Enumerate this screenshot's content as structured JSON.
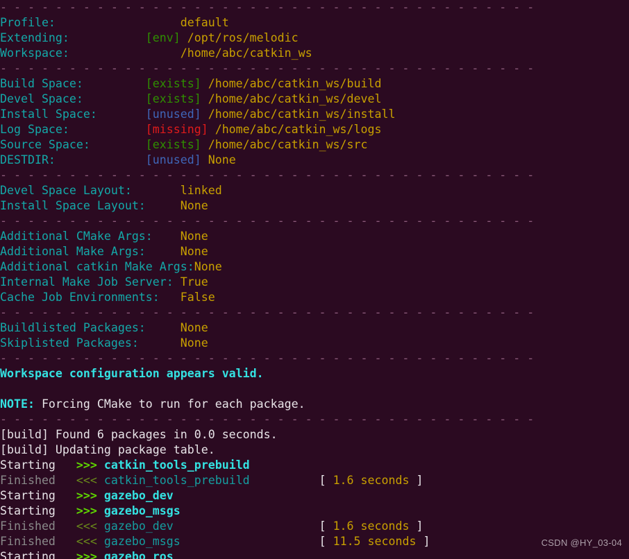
{
  "terminal": {
    "background_color": "#2b0a21",
    "separator_color": "#8b5a7a",
    "label_color": "#14a8a8",
    "value_color": "#c8a000",
    "separator_text": "- - - - - - - - - - - - - - - - - - - - - - - - - - - - - - - - - - - - - - -",
    "watermark": "CSDN @HY_03-04"
  },
  "config": {
    "profile": {
      "label": "Profile:",
      "status": "",
      "value": "default"
    },
    "extending": {
      "label": "Extending:",
      "status": "[env]",
      "status_kind": "ok",
      "value": "/opt/ros/melodic"
    },
    "workspace": {
      "label": "Workspace:",
      "status": "",
      "value": "/home/abc/catkin_ws"
    },
    "spaces": [
      {
        "label": "Build Space:",
        "status": "[exists]",
        "status_kind": "ok",
        "value": "/home/abc/catkin_ws/build"
      },
      {
        "label": "Devel Space:",
        "status": "[exists]",
        "status_kind": "ok",
        "value": "/home/abc/catkin_ws/devel"
      },
      {
        "label": "Install Space:",
        "status": "[unused]",
        "status_kind": "unused",
        "value": "/home/abc/catkin_ws/install"
      },
      {
        "label": "Log Space:",
        "status": "[missing]",
        "status_kind": "missing",
        "value": "/home/abc/catkin_ws/logs"
      },
      {
        "label": "Source Space:",
        "status": "[exists]",
        "status_kind": "ok",
        "value": "/home/abc/catkin_ws/src"
      },
      {
        "label": "DESTDIR:",
        "status": "[unused]",
        "status_kind": "unused",
        "value": "None"
      }
    ],
    "layouts": [
      {
        "label": "Devel Space Layout:",
        "value": "linked"
      },
      {
        "label": "Install Space Layout:",
        "value": "None"
      }
    ],
    "args": [
      {
        "label": "Additional CMake Args:",
        "value": "None"
      },
      {
        "label": "Additional Make Args:",
        "value": "None"
      },
      {
        "label": "Additional catkin Make Args:",
        "value": "None"
      },
      {
        "label": "Internal Make Job Server:",
        "value": "True"
      },
      {
        "label": "Cache Job Environments:",
        "value": "False"
      }
    ],
    "packages": [
      {
        "label": "Buildlisted Packages:",
        "value": "None"
      },
      {
        "label": "Skiplisted Packages:",
        "value": "None"
      }
    ]
  },
  "messages": {
    "valid": "Workspace configuration appears valid.",
    "note_prefix": "NOTE:",
    "note_text": " Forcing CMake to run for each package."
  },
  "build_log": {
    "found_packages": "[build] Found 6 packages in 0.0 seconds.",
    "updating_table": "[build] Updating package table.",
    "entries": [
      {
        "state": "Starting",
        "arrow": ">>>",
        "package": "catkin_tools_prebuild",
        "time": ""
      },
      {
        "state": "Finished",
        "arrow": "<<<",
        "package": "catkin_tools_prebuild",
        "time": "[ 1.6 seconds ]"
      },
      {
        "state": "Starting",
        "arrow": ">>>",
        "package": "gazebo_dev",
        "time": ""
      },
      {
        "state": "Starting",
        "arrow": ">>>",
        "package": "gazebo_msgs",
        "time": ""
      },
      {
        "state": "Finished",
        "arrow": "<<<",
        "package": "gazebo_dev",
        "time": "[ 1.6 seconds ]"
      },
      {
        "state": "Finished",
        "arrow": "<<<",
        "package": "gazebo_msgs",
        "time": "[ 11.5 seconds ]"
      },
      {
        "state": "Starting",
        "arrow": ">>>",
        "package": "gazebo_ros",
        "time": ""
      }
    ]
  }
}
